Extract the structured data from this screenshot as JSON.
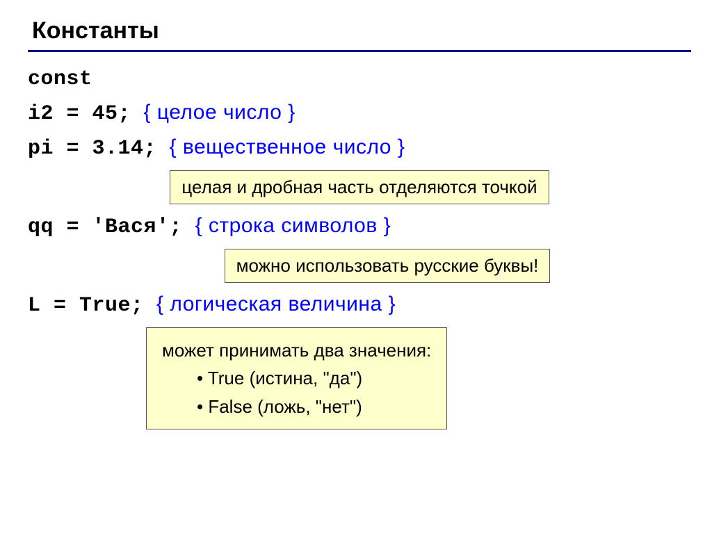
{
  "title": "Константы",
  "const_kw": "const",
  "lines": {
    "i2": {
      "code": "i2 = 45;",
      "comment": "{ целое число }"
    },
    "pi": {
      "code": "pi = 3.14;",
      "comment": "{ вещественное число }"
    },
    "qq": {
      "code": "qq = 'Вася';",
      "comment": "{ строка символов }"
    },
    "l": {
      "code": "L  = True;",
      "comment": "{ логическая величина }"
    }
  },
  "notes": {
    "decimal": "целая и дробная часть отделяются точкой",
    "russian": "можно использовать русские буквы!",
    "bool_header": "может принимать два значения:",
    "bool_true": "True (истина, \"да\")",
    "bool_false": "False (ложь, \"нет\")"
  }
}
